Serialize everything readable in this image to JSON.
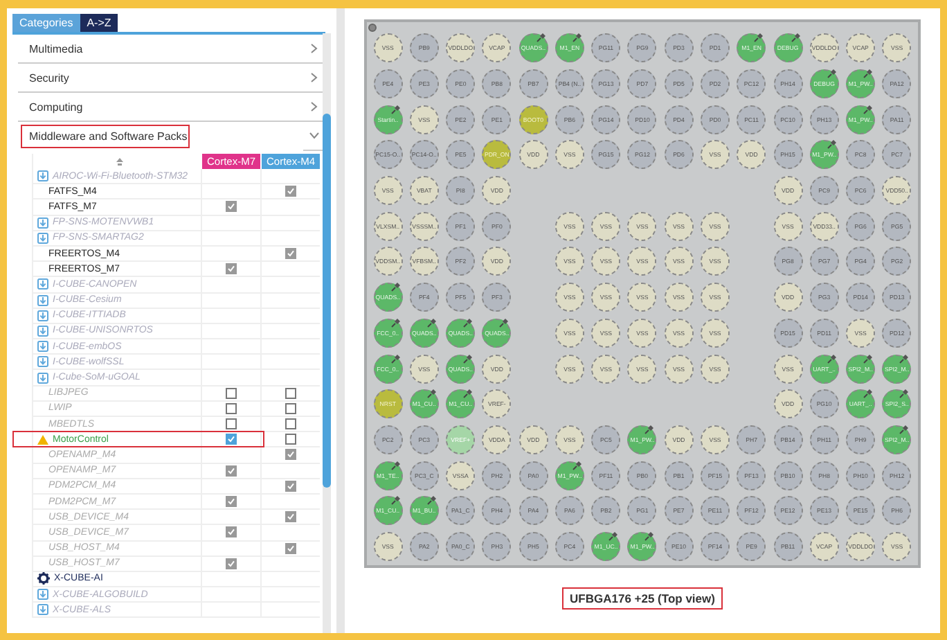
{
  "tabs": [
    {
      "label": "Categories",
      "selected": true
    },
    {
      "label": "A->Z",
      "selected": false
    }
  ],
  "categories": [
    {
      "label": "Multimedia",
      "expanded": false,
      "highlighted": false
    },
    {
      "label": "Security",
      "expanded": false,
      "highlighted": false
    },
    {
      "label": "Computing",
      "expanded": false,
      "highlighted": false
    },
    {
      "label": "Middleware and Software Packs",
      "expanded": true,
      "highlighted": true
    }
  ],
  "table": {
    "columns": [
      {
        "label": "Cortex-M7",
        "color": "#e0338a"
      },
      {
        "label": "Cortex-M4",
        "color": "#4ea3db"
      }
    ],
    "rows": [
      {
        "kind": "pack",
        "name": "AIROC-Wi-Fi-Bluetooth-STM32"
      },
      {
        "kind": "component",
        "name": "FATFS_M4",
        "available": true,
        "cortex_m4": {
          "checked": true,
          "disabled": true
        }
      },
      {
        "kind": "component",
        "name": "FATFS_M7",
        "available": true,
        "cortex_m7": {
          "checked": true,
          "disabled": true
        }
      },
      {
        "kind": "pack",
        "name": "FP-SNS-MOTENVWB1"
      },
      {
        "kind": "pack",
        "name": "FP-SNS-SMARTAG2"
      },
      {
        "kind": "component",
        "name": "FREERTOS_M4",
        "available": true,
        "cortex_m4": {
          "checked": true,
          "disabled": true
        }
      },
      {
        "kind": "component",
        "name": "FREERTOS_M7",
        "available": true,
        "cortex_m7": {
          "checked": true,
          "disabled": true
        }
      },
      {
        "kind": "pack",
        "name": "I-CUBE-CANOPEN"
      },
      {
        "kind": "pack",
        "name": "I-CUBE-Cesium"
      },
      {
        "kind": "pack",
        "name": "I-CUBE-ITTIADB"
      },
      {
        "kind": "pack",
        "name": "I-CUBE-UNISONRTOS"
      },
      {
        "kind": "pack",
        "name": "I-CUBE-embOS"
      },
      {
        "kind": "pack",
        "name": "I-CUBE-wolfSSL"
      },
      {
        "kind": "pack",
        "name": "I-Cube-SoM-uGOAL"
      },
      {
        "kind": "component",
        "name": "LIBJPEG",
        "available": false,
        "cortex_m7": {
          "checked": false,
          "disabled": false
        },
        "cortex_m4": {
          "checked": false,
          "disabled": false
        }
      },
      {
        "kind": "component",
        "name": "LWIP",
        "available": false,
        "cortex_m7": {
          "checked": false,
          "disabled": false
        },
        "cortex_m4": {
          "checked": false,
          "disabled": false
        }
      },
      {
        "kind": "component",
        "name": "MBEDTLS",
        "available": false,
        "cortex_m7": {
          "checked": false,
          "disabled": false
        },
        "cortex_m4": {
          "checked": false,
          "disabled": false
        }
      },
      {
        "kind": "warning",
        "name": "MotorControl",
        "highlighted": true,
        "cortex_m7": {
          "checked": true,
          "disabled": false
        },
        "cortex_m4": {
          "checked": false,
          "disabled": false
        }
      },
      {
        "kind": "component",
        "name": "OPENAMP_M4",
        "available": false,
        "cortex_m4": {
          "checked": true,
          "disabled": true
        }
      },
      {
        "kind": "component",
        "name": "OPENAMP_M7",
        "available": false,
        "cortex_m7": {
          "checked": true,
          "disabled": true
        }
      },
      {
        "kind": "component",
        "name": "PDM2PCM_M4",
        "available": false,
        "cortex_m4": {
          "checked": true,
          "disabled": true
        }
      },
      {
        "kind": "component",
        "name": "PDM2PCM_M7",
        "available": false,
        "cortex_m7": {
          "checked": true,
          "disabled": true
        }
      },
      {
        "kind": "component",
        "name": "USB_DEVICE_M4",
        "available": false,
        "cortex_m4": {
          "checked": true,
          "disabled": true
        }
      },
      {
        "kind": "component",
        "name": "USB_DEVICE_M7",
        "available": false,
        "cortex_m7": {
          "checked": true,
          "disabled": true
        }
      },
      {
        "kind": "component",
        "name": "USB_HOST_M4",
        "available": false,
        "cortex_m4": {
          "checked": true,
          "disabled": true
        }
      },
      {
        "kind": "component",
        "name": "USB_HOST_M7",
        "available": false,
        "cortex_m7": {
          "checked": true,
          "disabled": true
        }
      },
      {
        "kind": "installed",
        "name": "X-CUBE-AI"
      },
      {
        "kind": "pack",
        "name": "X-CUBE-ALGOBUILD"
      },
      {
        "kind": "pack",
        "name": "X-CUBE-ALS"
      }
    ]
  },
  "chip": {
    "package_label": {
      "text": "UFBGA176 +25 (Top view)",
      "highlighted": true
    },
    "rows": [
      [
        {
          "label": "VSS",
          "kind": "power"
        },
        {
          "label": "PB9",
          "kind": "io"
        },
        {
          "label": "VDDLDO",
          "kind": "power"
        },
        {
          "label": "VCAP",
          "kind": "power"
        },
        {
          "label": "QUADS..",
          "kind": "assigned"
        },
        {
          "label": "M1_EN",
          "kind": "assigned"
        },
        {
          "label": "PG11",
          "kind": "io"
        },
        {
          "label": "PG9",
          "kind": "io"
        },
        {
          "label": "PD3",
          "kind": "io"
        },
        {
          "label": "PD1",
          "kind": "io"
        },
        {
          "label": "M1_EN",
          "kind": "assigned"
        },
        {
          "label": "DEBUG",
          "kind": "assigned"
        },
        {
          "label": "VDDLDO",
          "kind": "power"
        },
        {
          "label": "VCAP",
          "kind": "power"
        },
        {
          "label": "VSS",
          "kind": "power"
        }
      ],
      [
        {
          "label": "PE4",
          "kind": "io"
        },
        {
          "label": "PE3",
          "kind": "io"
        },
        {
          "label": "PE0",
          "kind": "io"
        },
        {
          "label": "PB8",
          "kind": "io"
        },
        {
          "label": "PB7",
          "kind": "io"
        },
        {
          "label": "PB4 (N..",
          "kind": "io"
        },
        {
          "label": "PG13",
          "kind": "io"
        },
        {
          "label": "PD7",
          "kind": "io"
        },
        {
          "label": "PD5",
          "kind": "io"
        },
        {
          "label": "PD2",
          "kind": "io"
        },
        {
          "label": "PC12",
          "kind": "io"
        },
        {
          "label": "PH14",
          "kind": "io"
        },
        {
          "label": "DEBUG",
          "kind": "assigned"
        },
        {
          "label": "M1_PW..",
          "kind": "assigned"
        },
        {
          "label": "PA12",
          "kind": "io"
        }
      ],
      [
        {
          "label": "Startin..",
          "kind": "assigned"
        },
        {
          "label": "VSS",
          "kind": "power"
        },
        {
          "label": "PE2",
          "kind": "io"
        },
        {
          "label": "PE1",
          "kind": "io"
        },
        {
          "label": "BOOT0",
          "kind": "boot"
        },
        {
          "label": "PB6",
          "kind": "io"
        },
        {
          "label": "PG14",
          "kind": "io"
        },
        {
          "label": "PD10",
          "kind": "io"
        },
        {
          "label": "PD4",
          "kind": "io"
        },
        {
          "label": "PD0",
          "kind": "io"
        },
        {
          "label": "PC11",
          "kind": "io"
        },
        {
          "label": "PC10",
          "kind": "io"
        },
        {
          "label": "PH13",
          "kind": "io"
        },
        {
          "label": "M1_PW..",
          "kind": "assigned"
        },
        {
          "label": "PA11",
          "kind": "io"
        }
      ],
      [
        {
          "label": "PC15-O..",
          "kind": "io"
        },
        {
          "label": "PC14-O..",
          "kind": "io"
        },
        {
          "label": "PE5",
          "kind": "io"
        },
        {
          "label": "PDR_ON",
          "kind": "boot"
        },
        {
          "label": "VDD",
          "kind": "power"
        },
        {
          "label": "VSS",
          "kind": "power"
        },
        {
          "label": "PG15",
          "kind": "io"
        },
        {
          "label": "PG12",
          "kind": "io"
        },
        {
          "label": "PD6",
          "kind": "io"
        },
        {
          "label": "VSS",
          "kind": "power"
        },
        {
          "label": "VDD",
          "kind": "power"
        },
        {
          "label": "PH15",
          "kind": "io"
        },
        {
          "label": "M1_PW..",
          "kind": "assigned"
        },
        {
          "label": "PC8",
          "kind": "io"
        },
        {
          "label": "PC7",
          "kind": "io"
        }
      ],
      [
        {
          "label": "VSS",
          "kind": "power"
        },
        {
          "label": "VBAT",
          "kind": "power"
        },
        {
          "label": "PI8",
          "kind": "io"
        },
        {
          "label": "VDD",
          "kind": "power"
        },
        null,
        null,
        null,
        null,
        null,
        null,
        null,
        {
          "label": "VDD",
          "kind": "power"
        },
        {
          "label": "PC9",
          "kind": "io"
        },
        {
          "label": "PC6",
          "kind": "io"
        },
        {
          "label": "VDD50..",
          "kind": "power"
        }
      ],
      [
        {
          "label": "VLXSM..",
          "kind": "power"
        },
        {
          "label": "VSSSM..",
          "kind": "power"
        },
        {
          "label": "PF1",
          "kind": "io"
        },
        {
          "label": "PF0",
          "kind": "io"
        },
        null,
        {
          "label": "VSS",
          "kind": "power"
        },
        {
          "label": "VSS",
          "kind": "power"
        },
        {
          "label": "VSS",
          "kind": "power"
        },
        {
          "label": "VSS",
          "kind": "power"
        },
        {
          "label": "VSS",
          "kind": "power"
        },
        null,
        {
          "label": "VSS",
          "kind": "power"
        },
        {
          "label": "VDD33..",
          "kind": "power"
        },
        {
          "label": "PG6",
          "kind": "io"
        },
        {
          "label": "PG5",
          "kind": "io"
        }
      ],
      [
        {
          "label": "VDDSM..",
          "kind": "power"
        },
        {
          "label": "VFBSM..",
          "kind": "power"
        },
        {
          "label": "PF2",
          "kind": "io"
        },
        {
          "label": "VDD",
          "kind": "power"
        },
        null,
        {
          "label": "VSS",
          "kind": "power"
        },
        {
          "label": "VSS",
          "kind": "power"
        },
        {
          "label": "VSS",
          "kind": "power"
        },
        {
          "label": "VSS",
          "kind": "power"
        },
        {
          "label": "VSS",
          "kind": "power"
        },
        null,
        {
          "label": "PG8",
          "kind": "io"
        },
        {
          "label": "PG7",
          "kind": "io"
        },
        {
          "label": "PG4",
          "kind": "io"
        },
        {
          "label": "PG2",
          "kind": "io"
        }
      ],
      [
        {
          "label": "QUADS..",
          "kind": "assigned"
        },
        {
          "label": "PF4",
          "kind": "io"
        },
        {
          "label": "PF5",
          "kind": "io"
        },
        {
          "label": "PF3",
          "kind": "io"
        },
        null,
        {
          "label": "VSS",
          "kind": "power"
        },
        {
          "label": "VSS",
          "kind": "power"
        },
        {
          "label": "VSS",
          "kind": "power"
        },
        {
          "label": "VSS",
          "kind": "power"
        },
        {
          "label": "VSS",
          "kind": "power"
        },
        null,
        {
          "label": "VDD",
          "kind": "power"
        },
        {
          "label": "PG3",
          "kind": "io"
        },
        {
          "label": "PD14",
          "kind": "io"
        },
        {
          "label": "PD13",
          "kind": "io"
        }
      ],
      [
        {
          "label": "FCC_0..",
          "kind": "assigned"
        },
        {
          "label": "QUADS..",
          "kind": "assigned"
        },
        {
          "label": "QUADS..",
          "kind": "assigned"
        },
        {
          "label": "QUADS..",
          "kind": "assigned"
        },
        null,
        {
          "label": "VSS",
          "kind": "power"
        },
        {
          "label": "VSS",
          "kind": "power"
        },
        {
          "label": "VSS",
          "kind": "power"
        },
        {
          "label": "VSS",
          "kind": "power"
        },
        {
          "label": "VSS",
          "kind": "power"
        },
        null,
        {
          "label": "PD15",
          "kind": "io"
        },
        {
          "label": "PD11",
          "kind": "io"
        },
        {
          "label": "VSS",
          "kind": "power"
        },
        {
          "label": "PD12",
          "kind": "io"
        }
      ],
      [
        {
          "label": "FCC_0..",
          "kind": "assigned"
        },
        {
          "label": "VSS",
          "kind": "power"
        },
        {
          "label": "QUADS..",
          "kind": "assigned"
        },
        {
          "label": "VDD",
          "kind": "power"
        },
        null,
        {
          "label": "VSS",
          "kind": "power"
        },
        {
          "label": "VSS",
          "kind": "power"
        },
        {
          "label": "VSS",
          "kind": "power"
        },
        {
          "label": "VSS",
          "kind": "power"
        },
        {
          "label": "VSS",
          "kind": "power"
        },
        null,
        {
          "label": "VSS",
          "kind": "power"
        },
        {
          "label": "UART_..",
          "kind": "assigned"
        },
        {
          "label": "SPI2_M..",
          "kind": "assigned"
        },
        {
          "label": "SPI2_M..",
          "kind": "assigned"
        }
      ],
      [
        {
          "label": "NRST",
          "kind": "boot"
        },
        {
          "label": "M1_CU..",
          "kind": "assigned"
        },
        {
          "label": "M1_CU..",
          "kind": "assigned"
        },
        {
          "label": "VREF-",
          "kind": "power"
        },
        null,
        null,
        null,
        null,
        null,
        null,
        null,
        {
          "label": "VDD",
          "kind": "power"
        },
        {
          "label": "PG10",
          "kind": "io"
        },
        {
          "label": "UART_..",
          "kind": "assigned"
        },
        {
          "label": "SPI2_S..",
          "kind": "assigned"
        }
      ],
      [
        {
          "label": "PC2",
          "kind": "io"
        },
        {
          "label": "PC3",
          "kind": "io"
        },
        {
          "label": "VREF+",
          "kind": "analog"
        },
        {
          "label": "VDDA",
          "kind": "power"
        },
        {
          "label": "VDD",
          "kind": "power"
        },
        {
          "label": "VSS",
          "kind": "power"
        },
        {
          "label": "PC5",
          "kind": "io"
        },
        {
          "label": "M1_PW..",
          "kind": "assigned"
        },
        {
          "label": "VDD",
          "kind": "power"
        },
        {
          "label": "VSS",
          "kind": "power"
        },
        {
          "label": "PH7",
          "kind": "io"
        },
        {
          "label": "PB14",
          "kind": "io"
        },
        {
          "label": "PH11",
          "kind": "io"
        },
        {
          "label": "PH9",
          "kind": "io"
        },
        {
          "label": "SPI2_M..",
          "kind": "assigned"
        }
      ],
      [
        {
          "label": "M1_TE..",
          "kind": "assigned"
        },
        {
          "label": "PC3_C",
          "kind": "io"
        },
        {
          "label": "VSSA",
          "kind": "power"
        },
        {
          "label": "PH2",
          "kind": "io"
        },
        {
          "label": "PA0",
          "kind": "io"
        },
        {
          "label": "M1_PW..",
          "kind": "assigned"
        },
        {
          "label": "PF11",
          "kind": "io"
        },
        {
          "label": "PB0",
          "kind": "io"
        },
        {
          "label": "PB1",
          "kind": "io"
        },
        {
          "label": "PF15",
          "kind": "io"
        },
        {
          "label": "PF13",
          "kind": "io"
        },
        {
          "label": "PB10",
          "kind": "io"
        },
        {
          "label": "PH8",
          "kind": "io"
        },
        {
          "label": "PH10",
          "kind": "io"
        },
        {
          "label": "PH12",
          "kind": "io"
        }
      ],
      [
        {
          "label": "M1_CU..",
          "kind": "assigned"
        },
        {
          "label": "M1_BU..",
          "kind": "assigned"
        },
        {
          "label": "PA1_C",
          "kind": "io"
        },
        {
          "label": "PH4",
          "kind": "io"
        },
        {
          "label": "PA4",
          "kind": "io"
        },
        {
          "label": "PA6",
          "kind": "io"
        },
        {
          "label": "PB2",
          "kind": "io"
        },
        {
          "label": "PG1",
          "kind": "io"
        },
        {
          "label": "PE7",
          "kind": "io"
        },
        {
          "label": "PE11",
          "kind": "io"
        },
        {
          "label": "PF12",
          "kind": "io"
        },
        {
          "label": "PE12",
          "kind": "io"
        },
        {
          "label": "PE13",
          "kind": "io"
        },
        {
          "label": "PE15",
          "kind": "io"
        },
        {
          "label": "PH6",
          "kind": "io"
        }
      ],
      [
        {
          "label": "VSS",
          "kind": "power"
        },
        {
          "label": "PA2",
          "kind": "io"
        },
        {
          "label": "PA0_C",
          "kind": "io"
        },
        {
          "label": "PH3",
          "kind": "io"
        },
        {
          "label": "PH5",
          "kind": "io"
        },
        {
          "label": "PC4",
          "kind": "io"
        },
        {
          "label": "M1_UC..",
          "kind": "assigned"
        },
        {
          "label": "M1_PW..",
          "kind": "assigned"
        },
        {
          "label": "PE10",
          "kind": "io"
        },
        {
          "label": "PF14",
          "kind": "io"
        },
        {
          "label": "PE9",
          "kind": "io"
        },
        {
          "label": "PB11",
          "kind": "io"
        },
        {
          "label": "VCAP",
          "kind": "power"
        },
        {
          "label": "VDDLDO",
          "kind": "power"
        },
        {
          "label": "VSS",
          "kind": "power"
        }
      ]
    ]
  }
}
